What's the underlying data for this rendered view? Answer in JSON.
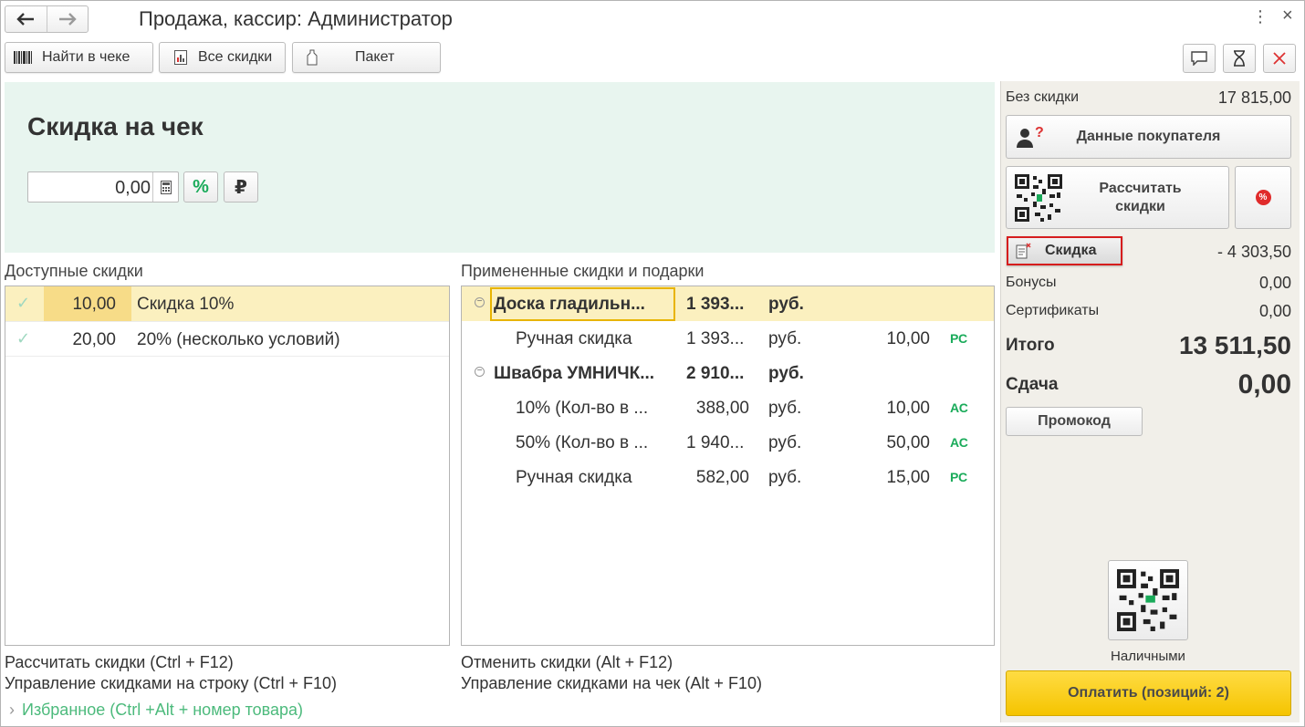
{
  "window": {
    "title": "Продажа, кассир: Администратор",
    "back_icon": "arrow-left-icon",
    "forward_icon": "arrow-right-icon",
    "menu_glyph": "⋮",
    "close_glyph": "×"
  },
  "toolbar": {
    "find_label": "Найти в чеке",
    "all_discounts_label": "Все скидки",
    "package_label": "Пакет"
  },
  "discount_panel": {
    "title": "Скидка на чек",
    "amount_value": "0,00",
    "percent_symbol": "%",
    "ruble_symbol": "₽"
  },
  "available": {
    "header": "Доступные скидки",
    "rows": [
      {
        "value": "10,00",
        "name": "Скидка 10%",
        "selected": true
      },
      {
        "value": "20,00",
        "name": "20% (несколько условий)",
        "selected": false
      }
    ]
  },
  "applied": {
    "header": "Примененные скидки и подарки",
    "rows": [
      {
        "name": "Доска гладильн...",
        "amount": "1 393...",
        "currency": "руб.",
        "percent": "",
        "tag": "",
        "group": true
      },
      {
        "name": "Ручная скидка",
        "amount": "1 393...",
        "currency": "руб.",
        "percent": "10,00",
        "tag": "РС",
        "group": false
      },
      {
        "name": "Швабра УМНИЧК...",
        "amount": "2 910...",
        "currency": "руб.",
        "percent": "",
        "tag": "",
        "group": true
      },
      {
        "name": "10% (Кол-во в ...",
        "amount": "388,00",
        "currency": "руб.",
        "percent": "10,00",
        "tag": "АС",
        "group": false
      },
      {
        "name": "50% (Кол-во в ...",
        "amount": "1 940...",
        "currency": "руб.",
        "percent": "50,00",
        "tag": "АС",
        "group": false
      },
      {
        "name": "Ручная скидка",
        "amount": "582,00",
        "currency": "руб.",
        "percent": "15,00",
        "tag": "РС",
        "group": false
      }
    ]
  },
  "hints": {
    "left1": "Рассчитать скидки (Ctrl + F12)",
    "left2": "Управление скидками на строку (Ctrl + F10)",
    "right1": "Отменить скидки (Alt + F12)",
    "right2": "Управление скидками на чек (Alt + F10)",
    "favorites": "Избранное (Ctrl +Alt + номер товара)"
  },
  "summary": {
    "no_discount_label": "Без скидки",
    "no_discount_value": "17 815,00",
    "customer_data_label": "Данные покупателя",
    "calc_discounts_label": "Рассчитать скидки",
    "discount_label": "Скидка",
    "discount_value": "- 4 303,50",
    "bonuses_label": "Бонусы",
    "bonuses_value": "0,00",
    "certificates_label": "Сертификаты",
    "certificates_value": "0,00",
    "total_label": "Итого",
    "total_value": "13 511,50",
    "change_label": "Сдача",
    "change_value": "0,00",
    "promo_label": "Промокод",
    "cash_label": "Наличными",
    "pay_label": "Оплатить (позиций: 2)"
  },
  "colors": {
    "panel_green": "#e8f5ef",
    "selected_row": "#fbf0bf",
    "pay_yellow": "#f5c400",
    "tag_green": "#1aab5a",
    "highlight_red": "#d61d1d"
  }
}
